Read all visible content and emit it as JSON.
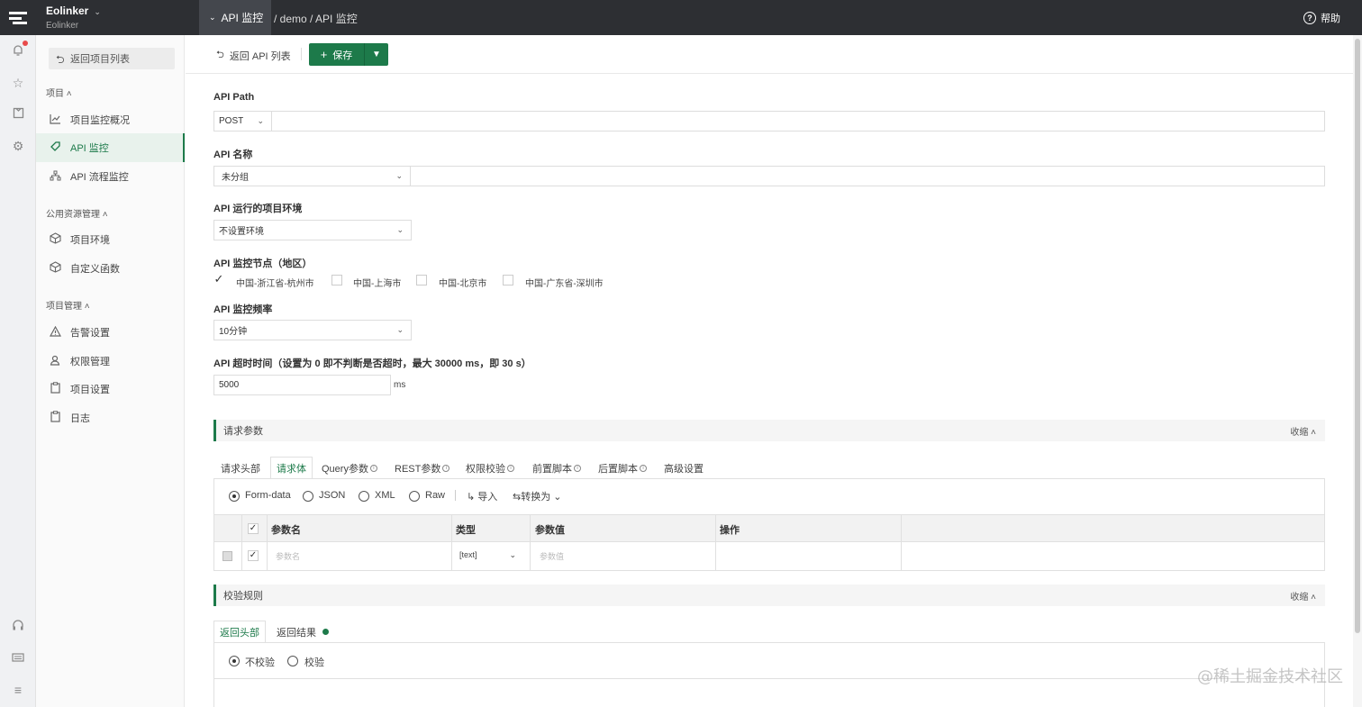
{
  "app": {
    "name": "Eolinker",
    "workspace": "Eolinker"
  },
  "breadcrumb": {
    "active": "API 监控",
    "rest": "/ demo / API 监控"
  },
  "header": {
    "help": "帮助"
  },
  "sidebar": {
    "back_label": "返回项目列表",
    "groups": [
      {
        "title": "项目",
        "items": [
          "项目监控概况",
          "API 监控",
          "API 流程监控"
        ]
      },
      {
        "title": "公用资源管理",
        "items": [
          "项目环境",
          "自定义函数"
        ]
      },
      {
        "title": "项目管理",
        "items": [
          "告警设置",
          "权限管理",
          "项目设置",
          "日志"
        ]
      }
    ]
  },
  "toolbar": {
    "back_label": "返回 API 列表",
    "save_label": "保存"
  },
  "form": {
    "path_label": "API Path",
    "method": "POST",
    "path_value": "",
    "name_label": "API 名称",
    "group_value": "未分组",
    "name_value": "",
    "env_label": "API 运行的项目环境",
    "env_value": "不设置环境",
    "nodes_label": "API 监控节点（地区）",
    "nodes": [
      {
        "label": "中国-浙江省-杭州市",
        "checked": true
      },
      {
        "label": "中国-上海市",
        "checked": false
      },
      {
        "label": "中国-北京市",
        "checked": false
      },
      {
        "label": "中国-广东省-深圳市",
        "checked": false
      }
    ],
    "freq_label": "API 监控频率",
    "freq_value": "10分钟",
    "timeout_label": "API 超时时间（设置为 0 即不判断是否超时，最大 30000 ms，即 30 s）",
    "timeout_value": "5000",
    "timeout_unit": "ms"
  },
  "request": {
    "section_title": "请求参数",
    "collapse_label": "收缩",
    "tabs": [
      "请求头部",
      "请求体",
      "Query参数",
      "REST参数",
      "权限校验",
      "前置脚本",
      "后置脚本",
      "高级设置"
    ],
    "body_types": [
      "Form-data",
      "JSON",
      "XML",
      "Raw"
    ],
    "import_label": "导入",
    "convert_label": "转换为",
    "table": {
      "headers": [
        "参数名",
        "类型",
        "参数值",
        "操作"
      ],
      "row": {
        "name_placeholder": "参数名",
        "type": "[text]",
        "value_placeholder": "参数值"
      }
    }
  },
  "validation": {
    "section_title": "校验规则",
    "collapse_label": "收缩",
    "tabs": [
      "返回头部",
      "返回结果"
    ],
    "options": [
      "不校验",
      "校验"
    ]
  },
  "watermark": "@稀土掘金技术社区",
  "colors": {
    "accent": "#1d7a4a",
    "topbar": "#2d2f33",
    "badge": "#e84a4a"
  }
}
